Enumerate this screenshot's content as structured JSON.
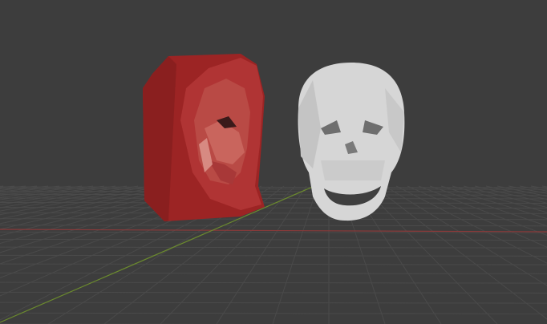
{
  "viewport": {
    "background": "#3d3d3d",
    "grid_color": "#4a4a4a",
    "x_axis_color": "#8a3a3a",
    "y_axis_color": "#6b8a2e"
  },
  "objects": [
    {
      "name": "red-skull-relief",
      "color": "#a52a2a"
    },
    {
      "name": "white-skull",
      "color": "#d4d4d4"
    }
  ]
}
